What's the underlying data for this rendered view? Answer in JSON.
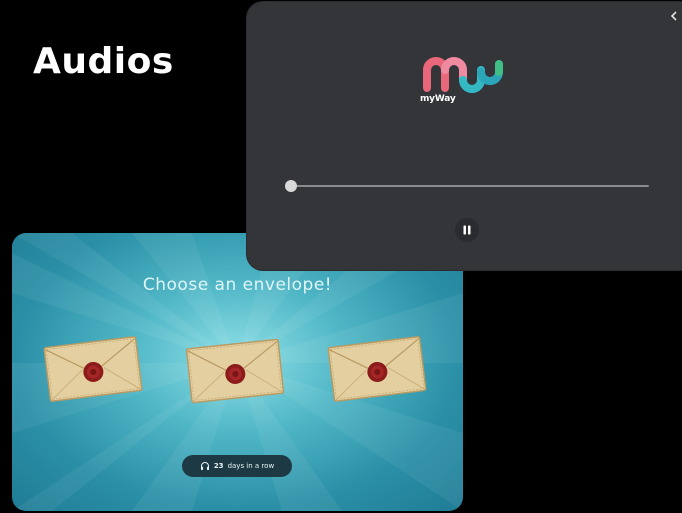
{
  "heading": {
    "text": "Audios"
  },
  "player": {
    "logo_text": "myWay",
    "progress": 0.0,
    "controls": {
      "pause_icon": "pause-icon",
      "close_icon": "close-icon"
    },
    "colors": {
      "background": "#333538",
      "logo_pink": "#e8677a",
      "logo_teal": "#33b8c4",
      "logo_green": "#3fbf86"
    }
  },
  "game": {
    "title": "Choose an envelope!",
    "envelopes": [
      {
        "icon": "envelope-icon"
      },
      {
        "icon": "envelope-icon"
      },
      {
        "icon": "envelope-icon"
      }
    ],
    "streak": {
      "count": "23",
      "suffix": "days in a row",
      "icon": "headphones-icon"
    },
    "colors": {
      "background": "#2a8fa6",
      "glow": "#8fe0e6"
    }
  }
}
